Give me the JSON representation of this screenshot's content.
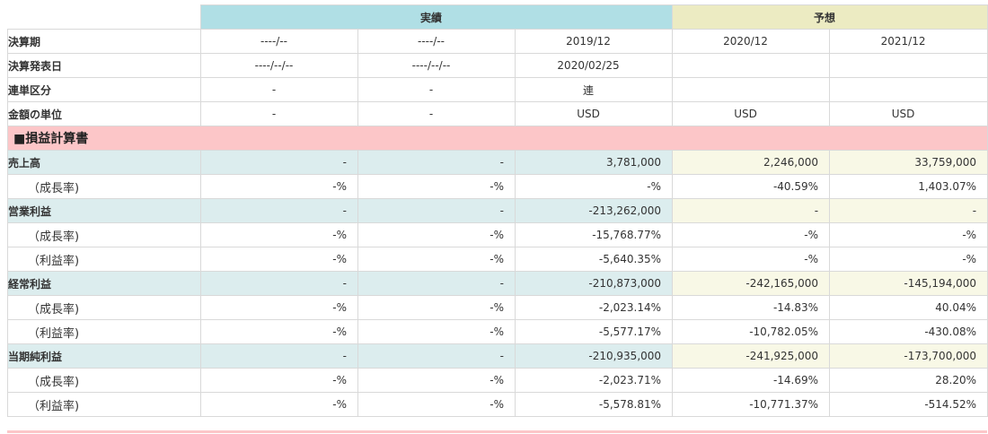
{
  "header": {
    "actual": "実績",
    "forecast": "予想"
  },
  "meta_rows": [
    {
      "label": "決算期",
      "values": [
        "----/--",
        "----/--",
        "2019/12",
        "2020/12",
        "2021/12"
      ]
    },
    {
      "label": "決算発表日",
      "values": [
        "----/--/--",
        "----/--/--",
        "2020/02/25",
        "",
        ""
      ]
    },
    {
      "label": "連単区分",
      "values": [
        "-",
        "-",
        "連",
        "",
        ""
      ]
    },
    {
      "label": "金額の単位",
      "values": [
        "-",
        "-",
        "USD",
        "USD",
        "USD"
      ]
    }
  ],
  "section": {
    "label": "■損益計算書"
  },
  "rows": [
    {
      "label": "売上高",
      "main": true,
      "values": [
        "-",
        "-",
        "3,781,000",
        "2,246,000",
        "33,759,000"
      ],
      "neg": [
        false,
        false,
        false,
        false,
        false
      ]
    },
    {
      "label": "（成長率)",
      "main": false,
      "values": [
        "-%",
        "-%",
        "-%",
        "-40.59%",
        "1,403.07%"
      ],
      "neg": [
        false,
        false,
        false,
        true,
        false
      ]
    },
    {
      "label": "営業利益",
      "main": true,
      "values": [
        "-",
        "-",
        "-213,262,000",
        "-",
        "-"
      ],
      "neg": [
        false,
        false,
        true,
        false,
        false
      ]
    },
    {
      "label": "（成長率)",
      "main": false,
      "values": [
        "-%",
        "-%",
        "-15,768.77%",
        "-%",
        "-%"
      ],
      "neg": [
        false,
        false,
        true,
        false,
        false
      ]
    },
    {
      "label": "（利益率)",
      "main": false,
      "values": [
        "-%",
        "-%",
        "-5,640.35%",
        "-%",
        "-%"
      ],
      "neg": [
        false,
        false,
        true,
        false,
        false
      ]
    },
    {
      "label": "経常利益",
      "main": true,
      "values": [
        "-",
        "-",
        "-210,873,000",
        "-242,165,000",
        "-145,194,000"
      ],
      "neg": [
        false,
        false,
        true,
        true,
        true
      ]
    },
    {
      "label": "（成長率)",
      "main": false,
      "values": [
        "-%",
        "-%",
        "-2,023.14%",
        "-14.83%",
        "40.04%"
      ],
      "neg": [
        false,
        false,
        true,
        true,
        false
      ]
    },
    {
      "label": "（利益率)",
      "main": false,
      "values": [
        "-%",
        "-%",
        "-5,577.17%",
        "-10,782.05%",
        "-430.08%"
      ],
      "neg": [
        false,
        false,
        true,
        true,
        true
      ]
    },
    {
      "label": "当期純利益",
      "main": true,
      "values": [
        "-",
        "-",
        "-210,935,000",
        "-241,925,000",
        "-173,700,000"
      ],
      "neg": [
        false,
        false,
        true,
        true,
        true
      ]
    },
    {
      "label": "（成長率)",
      "main": false,
      "values": [
        "-%",
        "-%",
        "-2,023.71%",
        "-14.69%",
        "28.20%"
      ],
      "neg": [
        false,
        false,
        true,
        true,
        false
      ]
    },
    {
      "label": "（利益率)",
      "main": false,
      "values": [
        "-%",
        "-%",
        "-5,578.81%",
        "-10,771.37%",
        "-514.52%"
      ],
      "neg": [
        false,
        false,
        true,
        true,
        true
      ]
    }
  ]
}
